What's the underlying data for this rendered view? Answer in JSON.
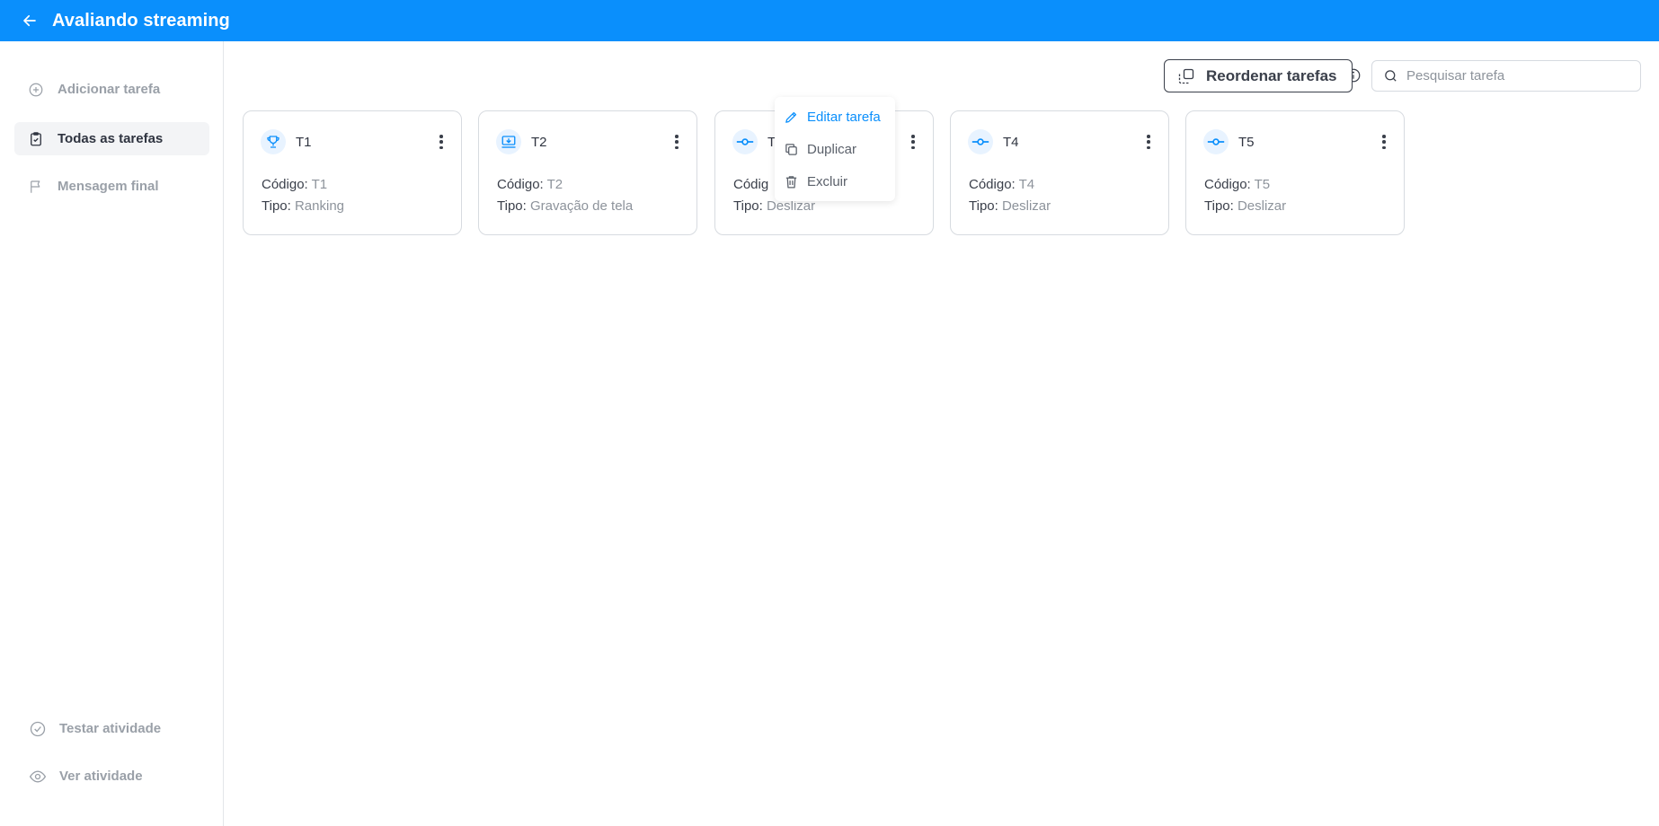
{
  "header": {
    "title": "Avaliando streaming"
  },
  "sidebar": {
    "add_label": "Adicionar tarefa",
    "all_label": "Todas as tarefas",
    "final_label": "Mensagem final",
    "test_label": "Testar atividade",
    "view_label": "Ver atividade"
  },
  "toolbar": {
    "reorder_label": "Reordenar tarefas",
    "search_placeholder": "Pesquisar tarefa"
  },
  "labels": {
    "code": "Código:",
    "type": "Tipo:"
  },
  "cards": [
    {
      "name": "T1",
      "code": "T1",
      "type": "Ranking",
      "icon": "trophy-icon"
    },
    {
      "name": "T2",
      "code": "T2",
      "type": "Gravação de tela",
      "icon": "screen-record-icon"
    },
    {
      "name": "T",
      "code": "Códig",
      "type": "Deslizar",
      "icon": "slider-icon"
    },
    {
      "name": "T4",
      "code": "T4",
      "type": "Deslizar",
      "icon": "slider-icon"
    },
    {
      "name": "T5",
      "code": "T5",
      "type": "Deslizar",
      "icon": "slider-icon"
    }
  ],
  "menu": {
    "edit": "Editar tarefa",
    "duplicate": "Duplicar",
    "delete": "Excluir"
  },
  "colors": {
    "primary": "#0a8ffc",
    "icon_bg": "#e8f3ff"
  }
}
